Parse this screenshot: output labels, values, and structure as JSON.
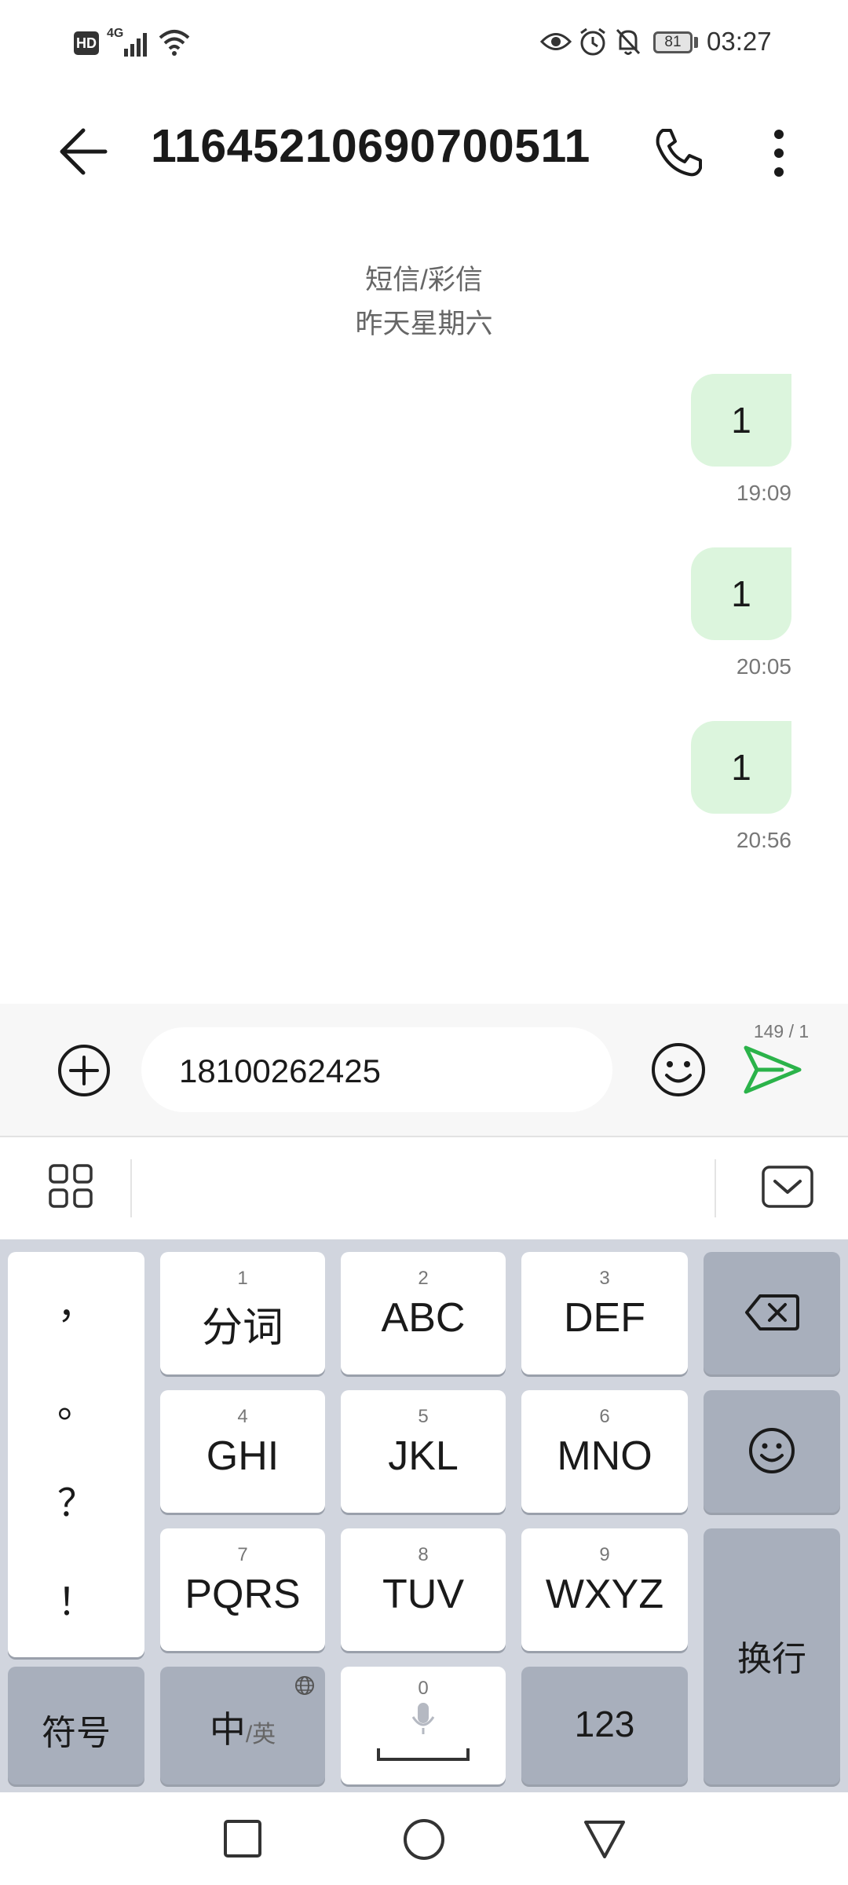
{
  "status_bar": {
    "hd": "HD",
    "network": "4G",
    "battery": "81",
    "time": "03:27",
    "icons": [
      "hd-icon",
      "signal-icon",
      "wifi-icon",
      "eye-icon",
      "alarm-icon",
      "bell-off-icon",
      "battery-icon"
    ]
  },
  "header": {
    "title": "11645210690700511",
    "icons": [
      "back-arrow-icon",
      "phone-icon",
      "more-vertical-icon"
    ]
  },
  "thread": {
    "kind": "短信/彩信",
    "date": "昨天星期六",
    "messages": [
      {
        "text": "1",
        "time": "19:09"
      },
      {
        "text": "1",
        "time": "20:05"
      },
      {
        "text": "1",
        "time": "20:56"
      }
    ]
  },
  "compose": {
    "value": "18100262425",
    "counter": "149 / 1",
    "icons": [
      "add-circle-icon",
      "emoji-icon",
      "send-icon"
    ]
  },
  "keyboard": {
    "punctuation": [
      "，",
      "。",
      "？",
      "！"
    ],
    "keys": [
      {
        "num": "1",
        "label": "分词"
      },
      {
        "num": "2",
        "label": "ABC"
      },
      {
        "num": "3",
        "label": "DEF"
      },
      {
        "num": "4",
        "label": "GHI"
      },
      {
        "num": "5",
        "label": "JKL"
      },
      {
        "num": "6",
        "label": "MNO"
      },
      {
        "num": "7",
        "label": "PQRS"
      },
      {
        "num": "8",
        "label": "TUV"
      },
      {
        "num": "9",
        "label": "WXYZ"
      }
    ],
    "symbols": "符号",
    "lang_main": "中",
    "lang_alt": "/英",
    "space_num": "0",
    "num_key": "123",
    "enter": "换行"
  },
  "colors": {
    "accent": "#2bb34a",
    "bubble": "#dcf5dd",
    "keyboard_bg": "#d1d5de",
    "function_key": "#a8afbc"
  }
}
